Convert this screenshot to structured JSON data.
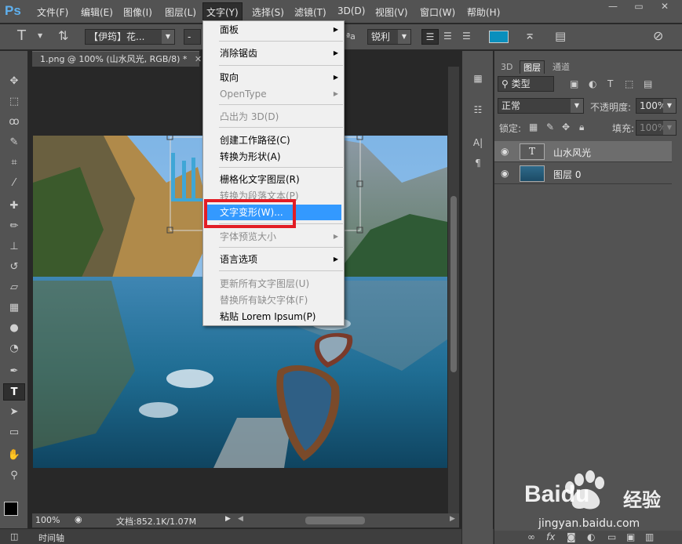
{
  "app": {
    "logo": "Ps",
    "accent_color": "#5fb0ee"
  },
  "menubar": {
    "items": [
      "文件(F)",
      "编辑(E)",
      "图像(I)",
      "图层(L)",
      "文字(Y)",
      "选择(S)",
      "滤镜(T)",
      "3D(D)",
      "视图(V)",
      "窗口(W)",
      "帮助(H)"
    ],
    "active_index": 4
  },
  "window_controls": [
    "minimize",
    "restore",
    "close"
  ],
  "options_bar": {
    "font_family": "【伊筠】花...",
    "font_size": "-",
    "aa_label": "ªa",
    "antialias": "锐利",
    "color_swatch": "#0a8fbd"
  },
  "document": {
    "tab_title": "1.png @ 100% (山水风光, RGB/8) *",
    "zoom": "100%",
    "doc_info": "文档:852.1K/1.07M"
  },
  "timeline": {
    "label": "时间轴"
  },
  "text_menu": {
    "items": [
      {
        "label": "面板",
        "submenu": true,
        "disabled": false
      },
      {
        "label": "消除锯齿",
        "submenu": true,
        "disabled": false
      },
      {
        "label": "取向",
        "submenu": true,
        "disabled": false
      },
      {
        "label": "OpenType",
        "submenu": true,
        "disabled": true
      },
      {
        "label": "凸出为 3D(D)",
        "submenu": false,
        "disabled": true
      },
      {
        "label": "创建工作路径(C)",
        "submenu": false,
        "disabled": false
      },
      {
        "label": "转换为形状(A)",
        "submenu": false,
        "disabled": false
      },
      {
        "label": "栅格化文字图层(R)",
        "submenu": false,
        "disabled": false
      },
      {
        "label": "转换为段落文本(P)",
        "submenu": false,
        "disabled": true
      },
      {
        "label": "文字变形(W)...",
        "submenu": false,
        "disabled": false,
        "highlighted": true
      },
      {
        "label": "字体预览大小",
        "submenu": true,
        "disabled": true
      },
      {
        "label": "语言选项",
        "submenu": true,
        "disabled": false
      },
      {
        "label": "更新所有文字图层(U)",
        "submenu": false,
        "disabled": true
      },
      {
        "label": "替换所有缺欠字体(F)",
        "submenu": false,
        "disabled": true
      },
      {
        "label": "粘贴 Lorem Ipsum(P)",
        "submenu": false,
        "disabled": false
      }
    ],
    "highlight_color": "#3399ff",
    "callout_color": "#e21d25"
  },
  "layers_panel": {
    "tabs": [
      "3D",
      "图层",
      "通道"
    ],
    "active_tab": 1,
    "filter_kind": "类型",
    "blend_mode": "正常",
    "opacity_label": "不透明度:",
    "opacity_value": "100%",
    "lock_label": "锁定:",
    "fill_label": "填充:",
    "fill_value": "100%",
    "layers": [
      {
        "name": "山水风光",
        "type": "text",
        "thumb_glyph": "T"
      },
      {
        "name": "图层 0",
        "type": "image"
      }
    ]
  },
  "watermark": {
    "brand": "Baidu",
    "cn": "经验",
    "url": "jingyan.baidu.com"
  }
}
